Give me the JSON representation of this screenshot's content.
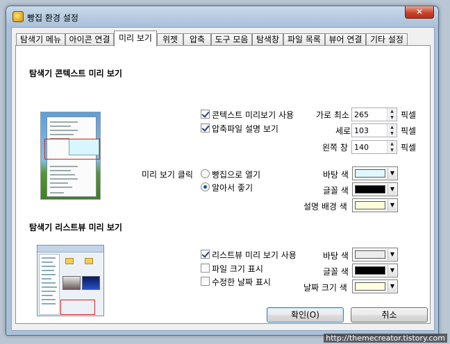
{
  "window": {
    "title": "빵집 환경 설정",
    "close_symbol": "✕"
  },
  "tabs": [
    {
      "label": "탐색기 메뉴",
      "active": false
    },
    {
      "label": "아이콘 연결",
      "active": false
    },
    {
      "label": "미리 보기",
      "active": true
    },
    {
      "label": "위젯",
      "active": false
    },
    {
      "label": "압축",
      "active": false
    },
    {
      "label": "도구 모음",
      "active": false
    },
    {
      "label": "탐색창",
      "active": false
    },
    {
      "label": "파일 목록",
      "active": false
    },
    {
      "label": "뷰어 연결",
      "active": false
    },
    {
      "label": "기타 설정",
      "active": false
    }
  ],
  "context_preview": {
    "section_title": "탐색기 콘텍스트 미리 보기",
    "use_preview": {
      "label": "콘텍스트 미리보기 사용",
      "checked": true
    },
    "archive_desc": {
      "label": "압축파일 설명 보기",
      "checked": true
    },
    "min_width": {
      "label": "가로 최소",
      "value": "265",
      "unit": "픽셀"
    },
    "height": {
      "label": "세로",
      "value": "103",
      "unit": "픽셀"
    },
    "left_pane": {
      "label": "왼쪽 창",
      "value": "140",
      "unit": "픽셀"
    },
    "click_label": "미리 보기 클릭",
    "open_with_bbangzip": {
      "label": "빵집으로 열기",
      "checked": false
    },
    "auto": {
      "label": "알아서 좋기",
      "checked": true
    },
    "background_color": {
      "label": "바탕 색",
      "color": "#dff8ff"
    },
    "font_color": {
      "label": "글꼴 색",
      "color": "#000000"
    },
    "desc_bg_color": {
      "label": "설명 배경 색",
      "color": "#ffffdc"
    }
  },
  "listview_preview": {
    "section_title": "탐색기 리스트뷰 미리 보기",
    "use_preview": {
      "label": "리스트뷰 미리 보기 사용",
      "checked": true
    },
    "show_file_size": {
      "label": "파일 크기 표시",
      "checked": false
    },
    "show_modified_date": {
      "label": "수정한 날짜 표시",
      "checked": false
    },
    "background_color": {
      "label": "바탕 색",
      "color": "#ececec"
    },
    "font_color": {
      "label": "글꼴 색",
      "color": "#000000"
    },
    "date_size_color": {
      "label": "날짜 크기 색",
      "color": "#ffffdc"
    }
  },
  "buttons": {
    "ok": "확인(O)",
    "cancel": "취소"
  },
  "watermark": "http://themecreator.tistory.com"
}
